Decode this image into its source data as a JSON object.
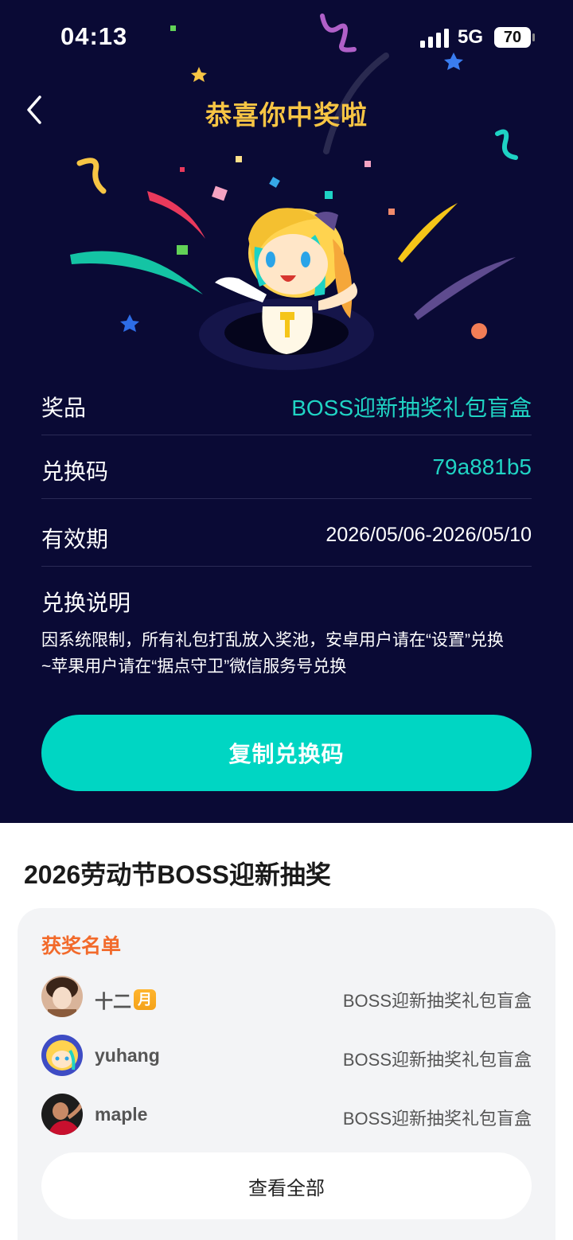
{
  "status_bar": {
    "time": "04:13",
    "network": "5G",
    "battery": "70"
  },
  "header": {
    "title": "恭喜你中奖啦"
  },
  "prize_info": {
    "prize_label": "奖品",
    "prize_value": "BOSS迎新抽奖礼包盲盒",
    "code_label": "兑换码",
    "code_value": "79a881b5",
    "validity_label": "有效期",
    "validity_value": "2026/05/06-2026/05/10",
    "note_title": "兑换说明",
    "note_line1": "因系统限制，所有礼包打乱放入奖池，安卓用户请在“设置”兑换",
    "note_line2": "~苹果用户请在“据点守卫”微信服务号兑换"
  },
  "copy_button": "复制兑换码",
  "event": {
    "title": "2026劳动节BOSS迎新抽奖",
    "winners_title": "获奖名单",
    "winners": [
      {
        "name": "十二",
        "badge": "月",
        "prize": "BOSS迎新抽奖礼包盲盒"
      },
      {
        "name": "yuhang",
        "prize": "BOSS迎新抽奖礼包盲盒"
      },
      {
        "name": "maple",
        "prize": "BOSS迎新抽奖礼包盲盒"
      }
    ],
    "view_all": "查看全部"
  },
  "colors": {
    "background": "#0a0a35",
    "accent": "#00d6c3",
    "title": "#f7c544",
    "winners_title": "#f26a2b"
  }
}
